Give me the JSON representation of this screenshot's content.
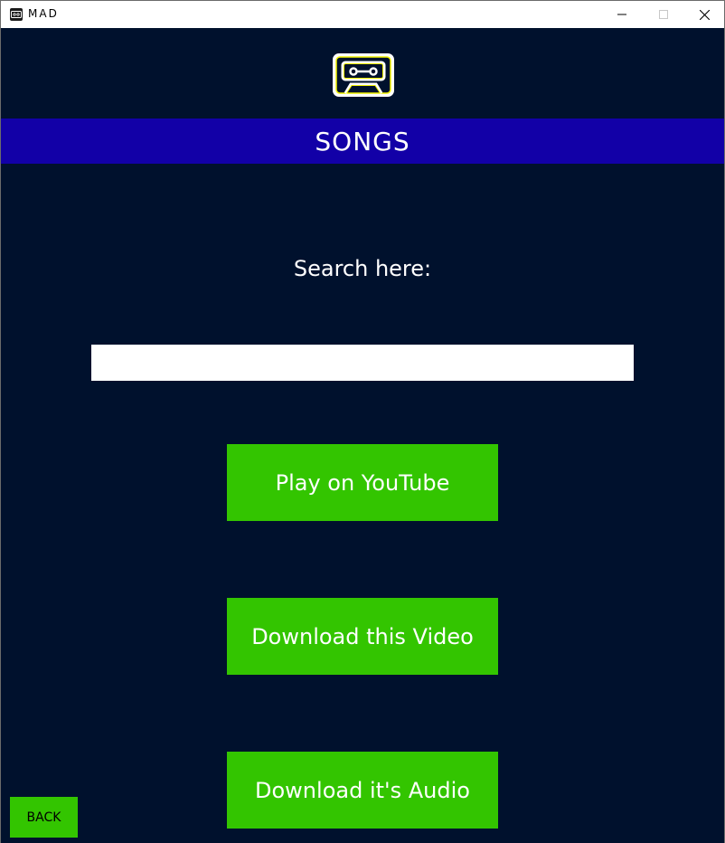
{
  "window": {
    "title": "MAD",
    "controls": {
      "minimize_icon": "minimize-icon",
      "maximize_icon": "maximize-icon",
      "close_icon": "close-icon"
    }
  },
  "header": {
    "logo_icon": "cassette-tape-icon",
    "title": "SONGS"
  },
  "search": {
    "label": "Search here:",
    "value": "",
    "placeholder": ""
  },
  "actions": {
    "play_label": "Play on YouTube",
    "download_video_label": "Download this Video",
    "download_audio_label": "Download it's Audio"
  },
  "back_label": "BACK",
  "colors": {
    "background": "#00112d",
    "header_band": "#1200a7",
    "button": "#33c500",
    "logo_outline": "#ffffff",
    "logo_inner": "#f2f200"
  }
}
